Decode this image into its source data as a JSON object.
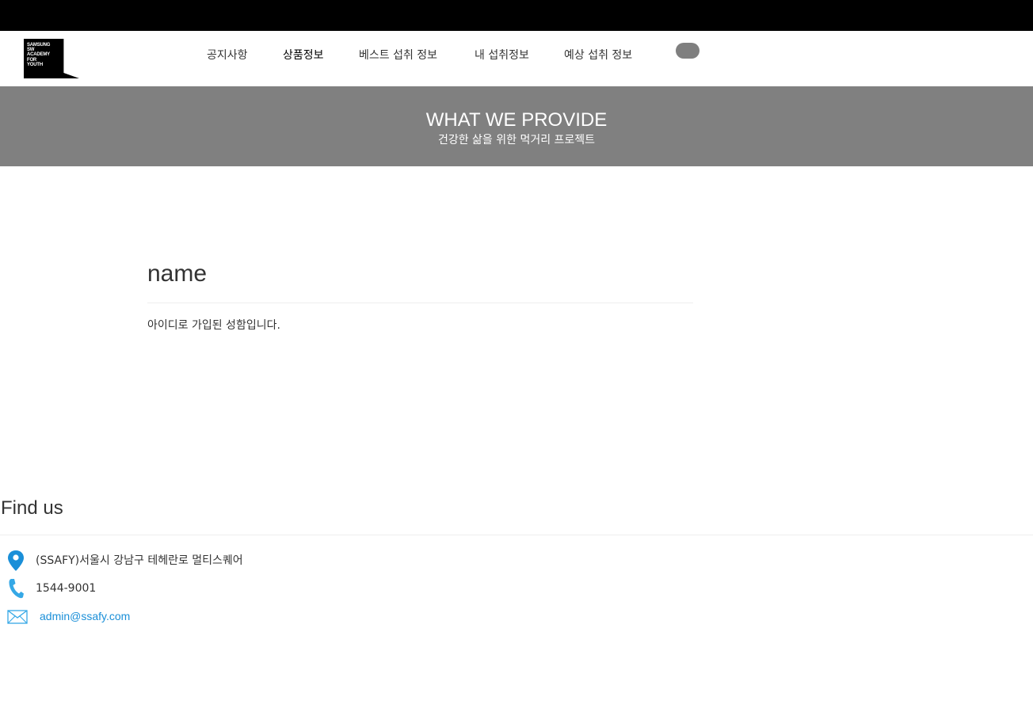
{
  "brand": {
    "logo_text": "SAMSUNG\nSW\nACADEMY\nFOR\nYOUTH",
    "logo_color": "#000000"
  },
  "nav": {
    "items": [
      {
        "label": "공지사항"
      },
      {
        "label": "상품정보"
      },
      {
        "label": "베스트 섭취 정보"
      },
      {
        "label": "내 섭취정보"
      },
      {
        "label": "예상 섭취 정보"
      }
    ],
    "active_index": 1,
    "toggle_color": "#7f7f7f"
  },
  "hero": {
    "title": "WHAT WE PROVIDE",
    "subtitle": "건강한 삶을 위한 먹거리 프로젝트",
    "background": "#808080"
  },
  "main": {
    "title": "name",
    "message": "아이디로 가입된 성함입니다."
  },
  "footer": {
    "title": "Find us",
    "address": {
      "icon": "map-pin-icon",
      "text": "(SSAFY)서울시 강남구 테헤란로 멀티스퀘어"
    },
    "phone": {
      "icon": "phone-icon",
      "text": "1544-9001"
    },
    "email": {
      "icon": "envelope-icon",
      "text": "admin@ssafy.com"
    },
    "accent_color": "#1a8fd8"
  }
}
